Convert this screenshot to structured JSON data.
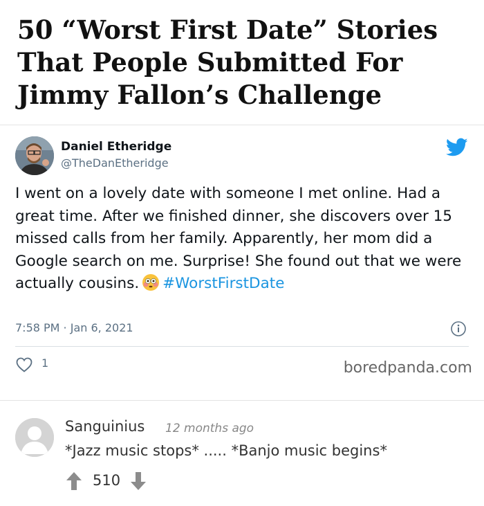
{
  "article": {
    "title": "50 “Worst First Date” Stories That People Submitted For Jimmy Fallon’s Challenge"
  },
  "tweet": {
    "author_name": "Daniel Etheridge",
    "author_handle": "@TheDanEtheridge",
    "text_before_emoji": "I went on a lovely date with someone I met online. Had a great time.  After we finished dinner, she discovers over 15 missed calls from her family. Apparently, her mom did a Google search on me. Surprise! She found out that we were actually cousins.",
    "hashtag": "#WorstFirstDate",
    "emoji": "flushed-face-emoji",
    "timestamp": "7:58 PM · Jan 6, 2021",
    "likes": "1",
    "brand_color": "#1d9bf0",
    "icons": [
      "twitter-bird-icon",
      "info-icon",
      "heart-icon"
    ]
  },
  "watermark": "boredpanda.com",
  "comment": {
    "username": "Sanguinius",
    "time": "12 months ago",
    "text": "*Jazz music stops* ..... *Banjo music begins*",
    "score": "510",
    "icons": [
      "upvote-arrow-icon",
      "downvote-arrow-icon"
    ]
  }
}
